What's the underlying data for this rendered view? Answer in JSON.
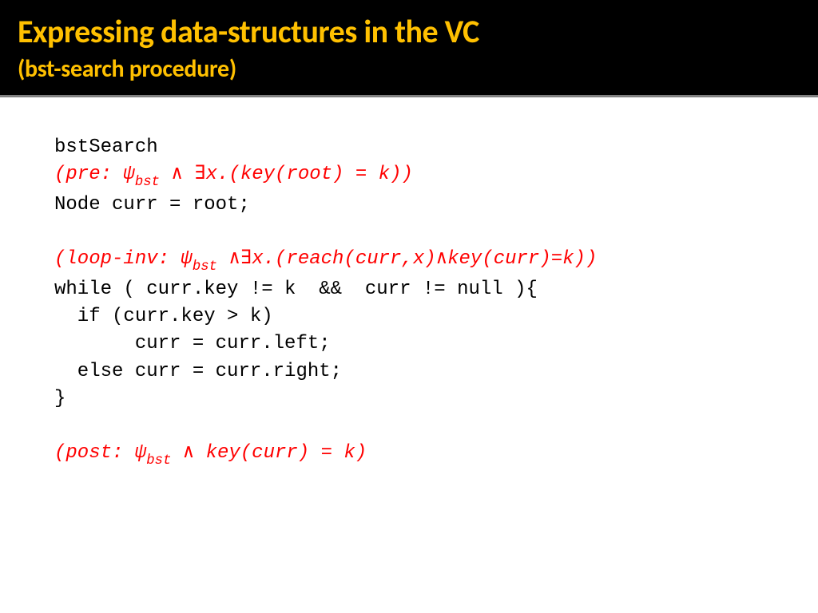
{
  "header": {
    "title": "Expressing data-structures in the VC",
    "subtitle": "(bst-search procedure)"
  },
  "code": {
    "name": "bstSearch",
    "pre_a": "(pre: ψ",
    "pre_sub": "bst",
    "pre_b": " ∧ ∃x.(key(root) = k))",
    "decl": "Node curr = root;",
    "loop_a": "(loop-inv: ψ",
    "loop_sub": "bst",
    "loop_b": " ∧∃x.(reach(curr,x)∧key(curr)=k))",
    "while": "while ( curr.key != k  &&  curr != null ){",
    "if": "  if (curr.key > k) ",
    "then": "       curr = curr.left;",
    "else": "  else curr = curr.right;",
    "close": "}",
    "post_a": "(post: ψ",
    "post_sub": "bst",
    "post_b": " ∧ key(curr) = k)"
  }
}
